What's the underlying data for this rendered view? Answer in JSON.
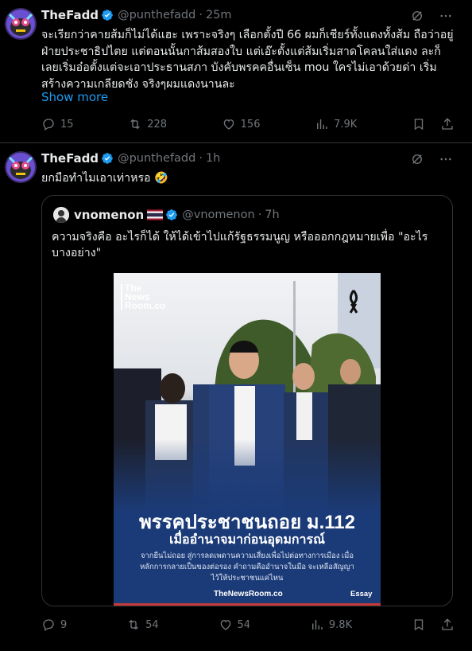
{
  "colors": {
    "background": "#000000",
    "text": "#e7e9ea",
    "muted": "#71767b",
    "accent": "#1d9bf0",
    "border": "#2f3336",
    "media_blue": "#1b3b78"
  },
  "tweets": [
    {
      "name": "TheFadd",
      "handle": "@punthefadd",
      "time": "25m",
      "text": "จะเรียกว่าคายส้มก็ไม่ได้แฮะ เพราะจริงๆ เลือกตั้งปี 66 ผมก็เชียร์ทั้งแดงทั้งส้ม ถือว่าอยู่ฝ่ายประชาธิปไตย แต่ตอนนั้นกาส้มสองใบ แต่เอ๊ะตั้งแต่ส้มเริ่มสาดโคลนใส่แดง ละก็เลยเริ่มอ๋อตั้งแต่จะเอาประธานสภา บังคับพรคคอื่นเซ็น mou ใครไม่เอาด้วยด่า เริ่มสร้างความเกลียดชัง จริงๆผมแดงนานละ",
      "show_more": "Show more",
      "stats": {
        "replies": "15",
        "reposts": "228",
        "likes": "156",
        "views": "7.9K"
      },
      "icons": [
        "grok-icon",
        "more-icon",
        "reply-icon",
        "repost-icon",
        "like-icon",
        "views-icon",
        "bookmark-icon",
        "share-icon"
      ]
    },
    {
      "name": "TheFadd",
      "handle": "@punthefadd",
      "time": "1h",
      "text": "ยกมือทำไมเอาเท่าหรอ 🤣",
      "stats": {
        "replies": "9",
        "reposts": "54",
        "likes": "54",
        "views": "9.8K"
      },
      "quote": {
        "name": "vnomenon",
        "handle": "@vnomenon",
        "time": "7h",
        "text": "ความจริงคือ อะไรก็ได้ ให้ได้เข้าไปแก้รัฐธรรมนูญ หรือออกกฎหมายเพื่อ \"อะไรบางอย่าง\"",
        "media": {
          "logo_lines": [
            "The",
            "News",
            "Room.co"
          ],
          "title": "พรรคประชาชนถอย ม.112",
          "subtitle": "เมื่ออำนาจมาก่อนอุดมการณ์",
          "description": "จากยืนไม่ถอย สู่การลดเพดานความเสี่ยงเพื่อไปต่อทางการเมือง เมื่อหลักการกลายเป็นของต่อรอง คำถามคืออำนาจในมือ จะเหลือสัญญาไว้ให้ประชาชนแค่ไหน",
          "footer_site": "TheNewsRoom.co",
          "footer_tag": "Essay"
        }
      }
    }
  ]
}
